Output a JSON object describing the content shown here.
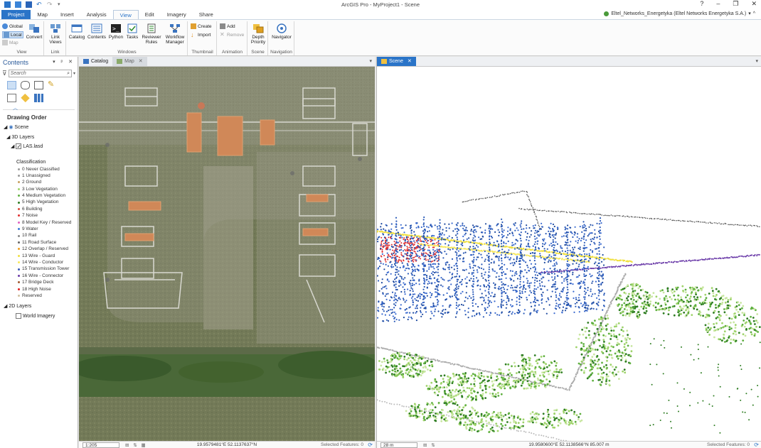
{
  "app": {
    "title": "ArcGIS Pro - MyProject1 - Scene",
    "account": "Eltel_Networks_Energetyka (Eltel Networks Energetyka S.A.)",
    "window_controls": [
      "?",
      "–",
      "❐",
      "✕"
    ]
  },
  "ribbon": {
    "tabs": [
      "Project",
      "Map",
      "Insert",
      "Analysis",
      "View",
      "Edit",
      "Imagery",
      "Share"
    ],
    "active_tab": "View",
    "groups": {
      "view": {
        "label": "View",
        "global": "Global",
        "local": "Local",
        "map": "Map",
        "convert": "Convert"
      },
      "link": {
        "label": "Link",
        "link_views": "Link Views"
      },
      "windows": {
        "label": "Windows",
        "catalog": "Catalog",
        "contents": "Contents",
        "python": "Python",
        "tasks": "Tasks",
        "reviewer_rules": "Reviewer Rules",
        "workflow_manager": "Workflow Manager"
      },
      "thumbnail": {
        "label": "Thumbnail",
        "create": "Create",
        "import": "Import"
      },
      "animation": {
        "label": "Animation",
        "add": "Add",
        "remove": "Remove"
      },
      "scene": {
        "label": "Scene",
        "depth_priority": "Depth Priority"
      },
      "navigation": {
        "label": "Navigation",
        "navigator": "Navigator"
      }
    }
  },
  "contents": {
    "title": "Contents",
    "controls": "▾ ᵖ ✕",
    "search_placeholder": "Search",
    "drawing_order": "Drawing Order",
    "scene": "Scene",
    "layers_3d": "3D Layers",
    "las_layer": "LAS.lasd",
    "classification_title": "Classification",
    "classes": [
      {
        "label": "0 Never Classified",
        "color": "#9a9a9a"
      },
      {
        "label": "1 Unassigned",
        "color": "#9a9a9a"
      },
      {
        "label": "2 Ground",
        "color": "#c8a060"
      },
      {
        "label": "3 Low Vegetation",
        "color": "#9ed36a"
      },
      {
        "label": "4 Medium Vegetation",
        "color": "#5fb040"
      },
      {
        "label": "5 High Vegetation",
        "color": "#2e7d22"
      },
      {
        "label": "6 Building",
        "color": "#d84a3a"
      },
      {
        "label": "7 Noise",
        "color": "#e03030"
      },
      {
        "label": "8 Model Key / Reserved",
        "color": "#e060c0"
      },
      {
        "label": "9 Water",
        "color": "#3a7ad8"
      },
      {
        "label": "10 Rail",
        "color": "#888888"
      },
      {
        "label": "11 Road Surface",
        "color": "#666666"
      },
      {
        "label": "12 Overlap / Reserved",
        "color": "#f0a020"
      },
      {
        "label": "13 Wire - Guard",
        "color": "#f0e040"
      },
      {
        "label": "14 Wire - Conductor",
        "color": "#f7e85a"
      },
      {
        "label": "15 Transmission Tower",
        "color": "#3a5ab8"
      },
      {
        "label": "16 Wire - Connector",
        "color": "#6a3aa8"
      },
      {
        "label": "17 Bridge Deck",
        "color": "#a05a30"
      },
      {
        "label": "18 High Noise",
        "color": "#e02020"
      },
      {
        "label": "Reserved",
        "color": "#d0c0a0"
      }
    ],
    "layers_2d": "2D Layers",
    "world_imagery": "World Imagery"
  },
  "map_view": {
    "tabs": [
      {
        "label": "Catalog"
      },
      {
        "label": "Map"
      }
    ],
    "scale": "1:205",
    "coordinates": "19.9579481°E 52.1137637°N",
    "selected": "Selected Features: 0"
  },
  "scene_view": {
    "tab": "Scene",
    "scale": "28 m",
    "coordinates": "19.9580600°E 52.1138566°N  85.007 m",
    "selected": "Selected Features: 0"
  }
}
